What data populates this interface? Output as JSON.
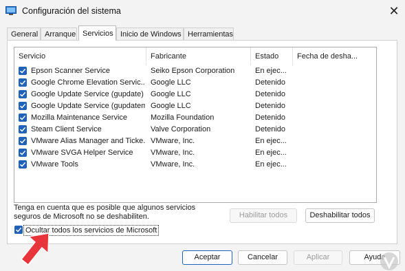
{
  "window": {
    "title": "Configuración del sistema",
    "close_glyph": "✕"
  },
  "tabs": [
    {
      "label": "General"
    },
    {
      "label": "Arranque"
    },
    {
      "label": "Servicios"
    },
    {
      "label": "Inicio de Windows"
    },
    {
      "label": "Herramientas"
    }
  ],
  "active_tab": "Servicios",
  "columns": [
    "Servicio",
    "Fabricante",
    "Estado",
    "Fecha de desha..."
  ],
  "services": [
    {
      "name": "Epson Scanner Service",
      "maker": "Seiko Epson Corporation",
      "status": "En ejec...",
      "checked": true
    },
    {
      "name": "Google Chrome Elevation Servic...",
      "maker": "Google LLC",
      "status": "Detenido",
      "checked": true
    },
    {
      "name": "Google Update Service (gupdate)",
      "maker": "Google LLC",
      "status": "Detenido",
      "checked": true
    },
    {
      "name": "Google Update Service (gupdatem)",
      "maker": "Google LLC",
      "status": "Detenido",
      "checked": true
    },
    {
      "name": "Mozilla Maintenance Service",
      "maker": "Mozilla Foundation",
      "status": "Detenido",
      "checked": true
    },
    {
      "name": "Steam Client Service",
      "maker": "Valve Corporation",
      "status": "Detenido",
      "checked": true
    },
    {
      "name": "VMware Alias Manager and Ticke...",
      "maker": "VMware, Inc.",
      "status": "En ejec...",
      "checked": true
    },
    {
      "name": "VMware SVGA Helper Service",
      "maker": "VMware, Inc.",
      "status": "En ejec...",
      "checked": true
    },
    {
      "name": "VMware Tools",
      "maker": "VMware, Inc.",
      "status": "En ejec...",
      "checked": true
    }
  ],
  "note": "Tenga en cuenta que es posible que algunos servicios seguros de Microsoft no se deshabiliten.",
  "buttons": {
    "enable_all": "Habilitar todos",
    "disable_all": "Deshabilitar todos",
    "ok": "Aceptar",
    "cancel": "Cancelar",
    "apply": "Aplicar",
    "help": "Ayuda"
  },
  "hide_ms": {
    "label": "Ocultar todos los servicios de Microsoft",
    "checked": true
  },
  "colors": {
    "accent": "#1f62b8",
    "arrow": "#e8353b"
  },
  "icons": {
    "app": "system-config-icon",
    "check": "checkmark-icon",
    "arrow": "pointer-arrow-icon"
  }
}
